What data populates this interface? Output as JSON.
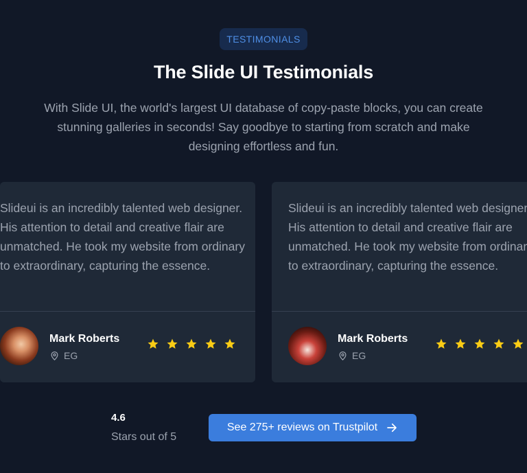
{
  "header": {
    "badge": "TESTIMONIALS",
    "title": "The Slide UI Testimonials",
    "subtitle": "With Slide UI, the world's largest UI database of copy-paste blocks, you can create stunning galleries in seconds! Say goodbye to starting from scratch and make designing effortless and fun."
  },
  "testimonials": [
    {
      "quote": "Slideui is an incredibly talented web designer. His attention to detail and creative flair are unmatched. He took my website from ordinary to extraordinary, capturing the essence.",
      "name": "Mark Roberts",
      "location": "EG",
      "stars": 5
    },
    {
      "quote": "Slideui is an incredibly talented web designer. His attention to detail and creative flair are unmatched. He took my website from ordinary to extraordinary, capturing the essence.",
      "name": "Mark Roberts",
      "location": "EG",
      "stars": 5
    }
  ],
  "rating": {
    "value": "4.6",
    "caption": "Stars out of 5"
  },
  "cta": {
    "label": "See 275+ reviews on Trustpilot",
    "icon": "arrow-right-icon"
  },
  "colors": {
    "background": "#111827",
    "card": "#1f2937",
    "accent": "#3b7ddd",
    "star": "#facc15"
  }
}
